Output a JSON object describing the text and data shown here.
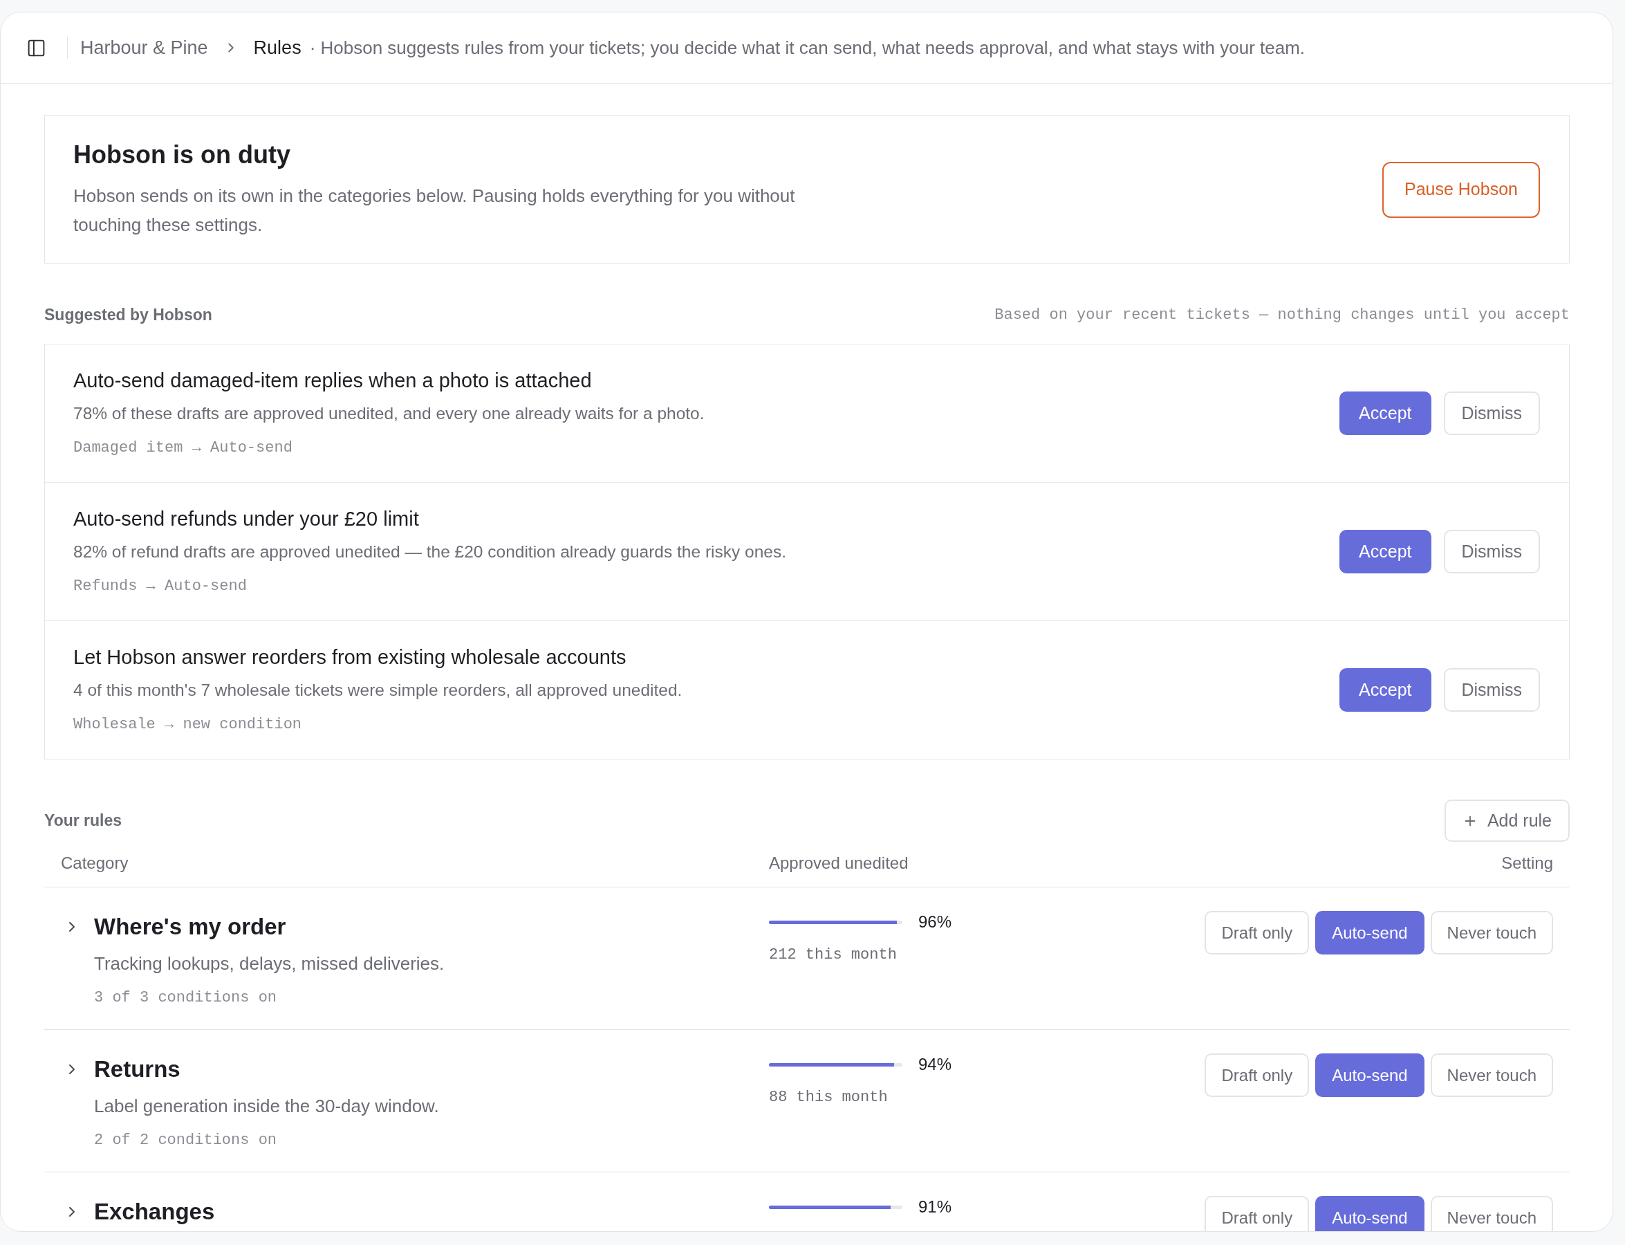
{
  "header": {
    "breadcrumb": [
      {
        "label": "Harbour & Pine",
        "current": false
      },
      {
        "label": "Rules",
        "current": true
      }
    ],
    "description": "· Hobson suggests rules from your tickets; you decide what it can send, what needs approval, and what stays with your team."
  },
  "status_card": {
    "title": "Hobson is on duty",
    "text": "Hobson sends on its own in the categories below. Pausing holds everything for you without touching these settings.",
    "button": "Pause Hobson"
  },
  "suggestions": {
    "title": "Suggested by Hobson",
    "note": "Based on your recent tickets — nothing changes until you accept",
    "items": [
      {
        "title": "Auto-send damaged-item replies when a photo is attached",
        "text": "78% of these drafts are approved unedited, and every one already waits for a photo.",
        "tag": "Damaged item → Auto-send",
        "accept": "Accept",
        "dismiss": "Dismiss"
      },
      {
        "title": "Auto-send refunds under your £20 limit",
        "text": "82% of refund drafts are approved unedited — the £20 condition already guards the risky ones.",
        "tag": "Refunds → Auto-send",
        "accept": "Accept",
        "dismiss": "Dismiss"
      },
      {
        "title": "Let Hobson answer reorders from existing wholesale accounts",
        "text": "4 of this month's 7 wholesale tickets were simple reorders, all approved unedited.",
        "tag": "Wholesale → new condition",
        "accept": "Accept",
        "dismiss": "Dismiss"
      }
    ]
  },
  "rules": {
    "title": "Your rules",
    "add_button": "Add rule",
    "columns": [
      "Category",
      "Approved unedited",
      "Setting"
    ],
    "rows": [
      {
        "name": "Where's my order",
        "text": "Tracking lookups, delays, missed deliveries.",
        "conditions": "3 of 3 conditions on",
        "expanded": false,
        "level": 0.96,
        "percent": "96%",
        "count": "212 this month",
        "options": [
          {
            "label": "Draft only",
            "selected": false
          },
          {
            "label": "Auto-send",
            "selected": true
          },
          {
            "label": "Never touch",
            "selected": false
          }
        ]
      },
      {
        "name": "Returns",
        "text": "Label generation inside the 30-day window.",
        "conditions": "2 of 2 conditions on",
        "expanded": false,
        "level": 0.94,
        "percent": "94%",
        "count": "88 this month",
        "options": [
          {
            "label": "Draft only",
            "selected": false
          },
          {
            "label": "Auto-send",
            "selected": true
          },
          {
            "label": "Never touch",
            "selected": false
          }
        ]
      },
      {
        "name": "Exchanges",
        "expanded": false,
        "level": 0.91,
        "percent": "91%",
        "options": [
          {
            "label": "Draft only",
            "selected": false
          },
          {
            "label": "Auto-send",
            "selected": true
          },
          {
            "label": "Never touch",
            "selected": false
          }
        ]
      }
    ]
  }
}
